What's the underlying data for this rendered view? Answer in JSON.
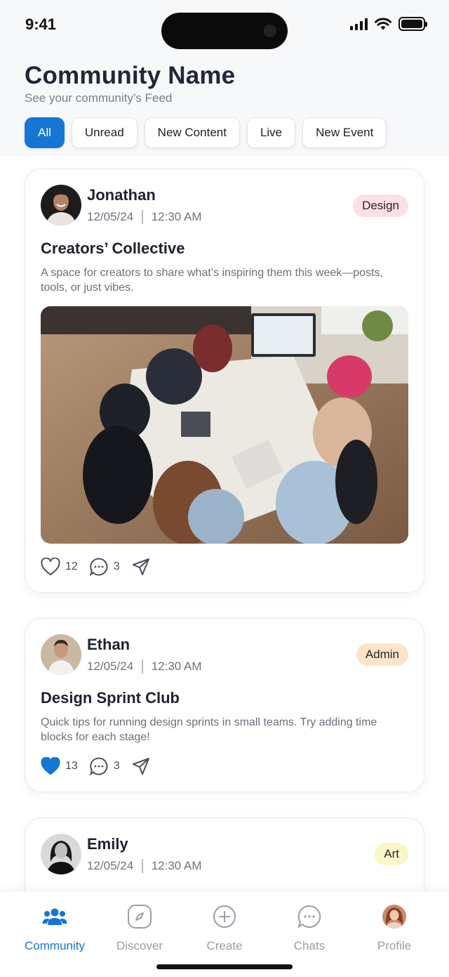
{
  "status": {
    "time": "9:41"
  },
  "header": {
    "title": "Community Name",
    "subtitle": "See your community’s Feed"
  },
  "filters": [
    {
      "label": "All",
      "active": true
    },
    {
      "label": "Unread",
      "active": false
    },
    {
      "label": "New Content",
      "active": false
    },
    {
      "label": "Live",
      "active": false
    },
    {
      "label": "New Event",
      "active": false
    }
  ],
  "posts": [
    {
      "author": "Jonathan",
      "date": "12/05/24",
      "time": "12:30 AM",
      "tag": "Design",
      "tag_bg": "#fde0e4",
      "tag_color": "#2a2a2a",
      "title": "Creators’ Collective",
      "body": "A space for creators to share what’s inspiring them this week—posts, tools, or just vibes.",
      "likes": "12",
      "comments": "3",
      "liked": false
    },
    {
      "author": "Ethan",
      "date": "12/05/24",
      "time": "12:30 AM",
      "tag": "Admin",
      "tag_bg": "#fde4c6",
      "tag_color": "#2a2a2a",
      "title": "Design Sprint Club",
      "body": "Quick tips for running design sprints in small teams. Try adding time blocks for each stage!",
      "likes": "13",
      "comments": "3",
      "liked": true
    },
    {
      "author": "Emily",
      "date": "12/05/24",
      "time": "12:30 AM",
      "tag": "Art",
      "tag_bg": "#fbf6c8",
      "tag_color": "#2a2a2a"
    }
  ],
  "tabbar": [
    {
      "label": "Community",
      "icon": "community-icon",
      "active": true
    },
    {
      "label": "Discover",
      "icon": "compass-icon",
      "active": false
    },
    {
      "label": "Create",
      "icon": "plus-circle-icon",
      "active": false
    },
    {
      "label": "Chats",
      "icon": "chat-icon",
      "active": false
    },
    {
      "label": "Profile",
      "icon": "profile-avatar",
      "active": false
    }
  ],
  "colors": {
    "accent": "#1576d4",
    "liked": "#1576d4"
  }
}
